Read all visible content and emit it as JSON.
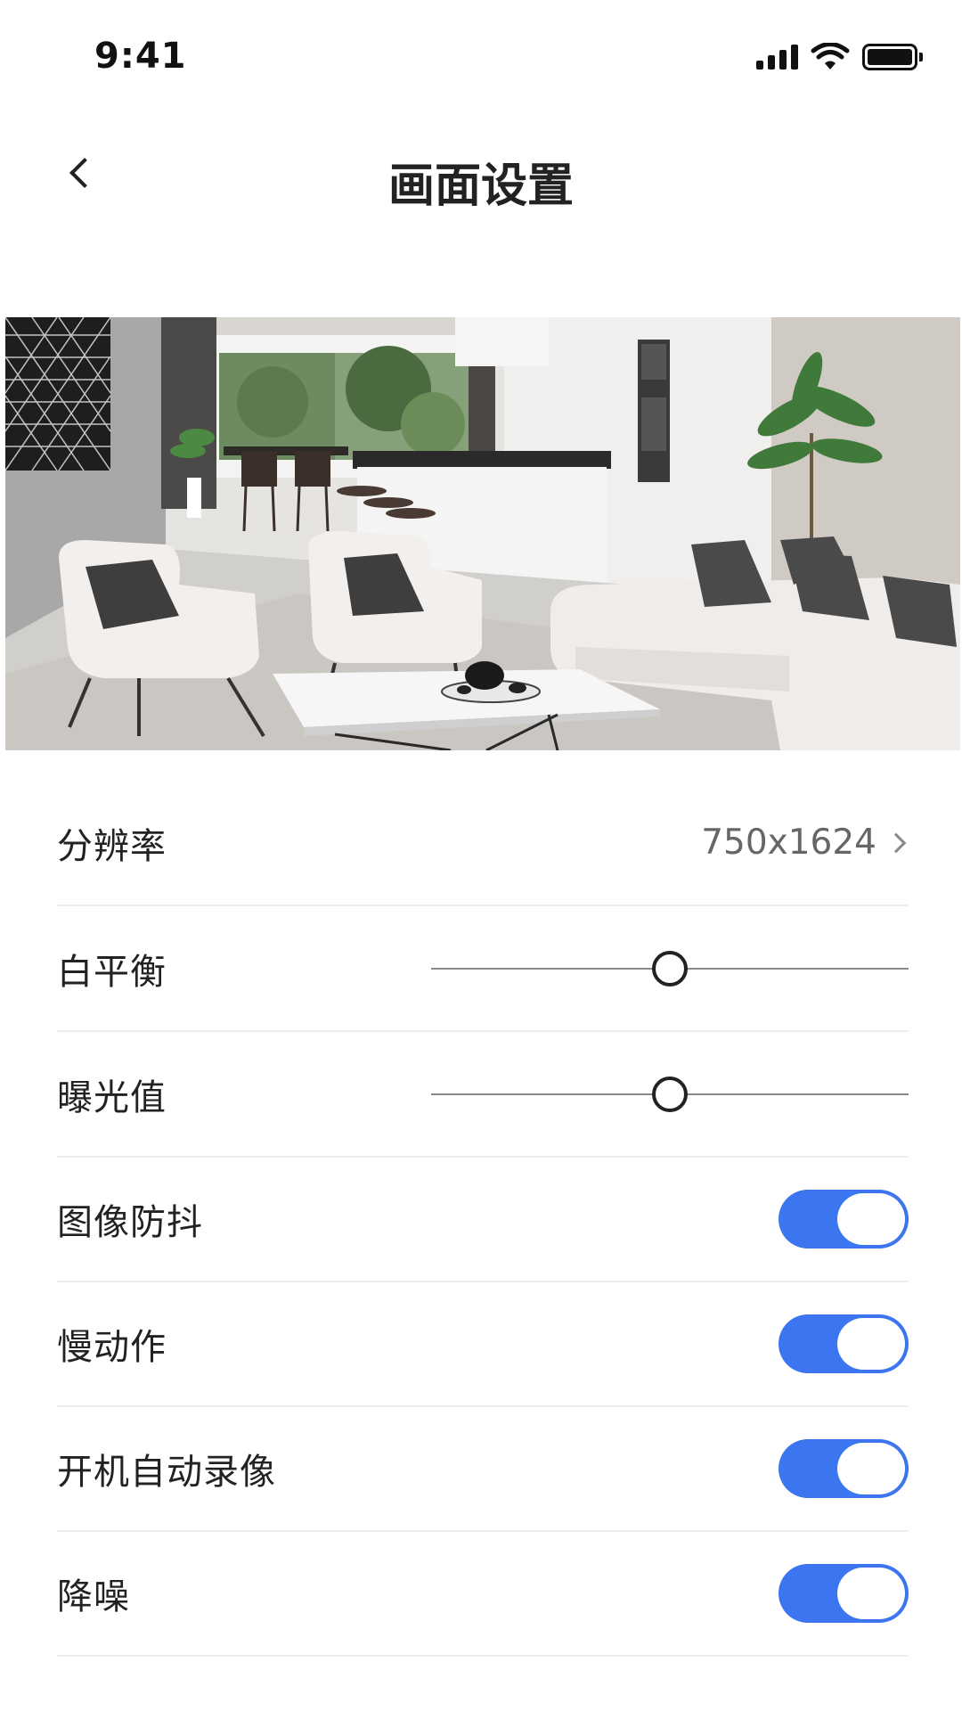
{
  "status_bar": {
    "time": "9:41",
    "icons": [
      "signal-icon",
      "wifi-icon",
      "battery-icon"
    ]
  },
  "nav": {
    "title": "画面设置",
    "back_icon": "chevron-left-icon"
  },
  "settings": {
    "resolution": {
      "label": "分辨率",
      "value": "750x1624"
    },
    "white_balance": {
      "label": "白平衡",
      "level": 0.5
    },
    "exposure": {
      "label": "曝光值",
      "level": 0.5
    },
    "stabilization": {
      "label": "图像防抖",
      "on": true
    },
    "slow_motion": {
      "label": "慢动作",
      "on": true
    },
    "auto_record": {
      "label": "开机自动录像",
      "on": true
    },
    "noise_reduction": {
      "label": "降噪",
      "on": true
    }
  },
  "colors": {
    "toggle_on": "#3b75f0",
    "divider": "#eeeeee",
    "text_primary": "#222222",
    "text_secondary": "#666666"
  }
}
